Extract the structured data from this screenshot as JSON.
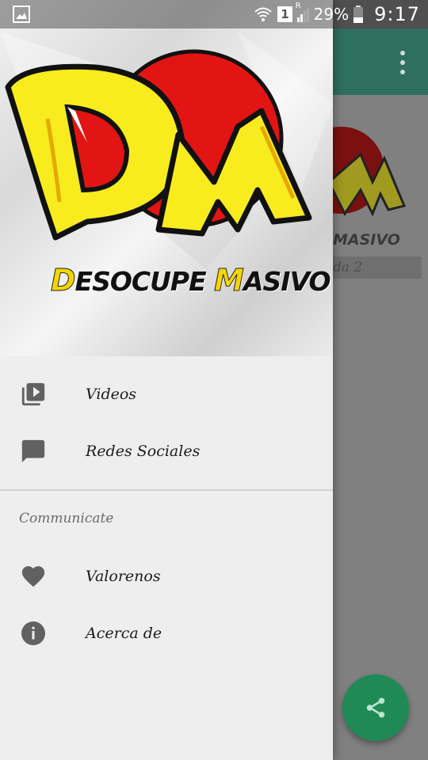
{
  "status_bar": {
    "time": "9:17",
    "battery": "29%",
    "sim_slot": "1",
    "roaming": "R"
  },
  "background_app": {
    "logo_text": "MASIVO",
    "card_text": "da 2"
  },
  "drawer": {
    "header": {
      "logo_letters": "DM",
      "title_d": "D",
      "title_part1": "ESOCUPE ",
      "title_m": "M",
      "title_part2": "ASIVO"
    },
    "items": [
      {
        "label": "Videos",
        "icon": "video-library-icon"
      },
      {
        "label": "Redes Sociales",
        "icon": "chat-bubble-icon"
      }
    ],
    "section_title": "Communicate",
    "section_items": [
      {
        "label": "Valorenos",
        "icon": "heart-icon"
      },
      {
        "label": "Acerca de",
        "icon": "info-icon"
      }
    ]
  },
  "colors": {
    "toolbar": "#2e6f60",
    "fab": "#1f8a55",
    "logo_yellow": "#f8ec1e",
    "logo_red": "#e31414",
    "icon_gray": "#616161"
  }
}
